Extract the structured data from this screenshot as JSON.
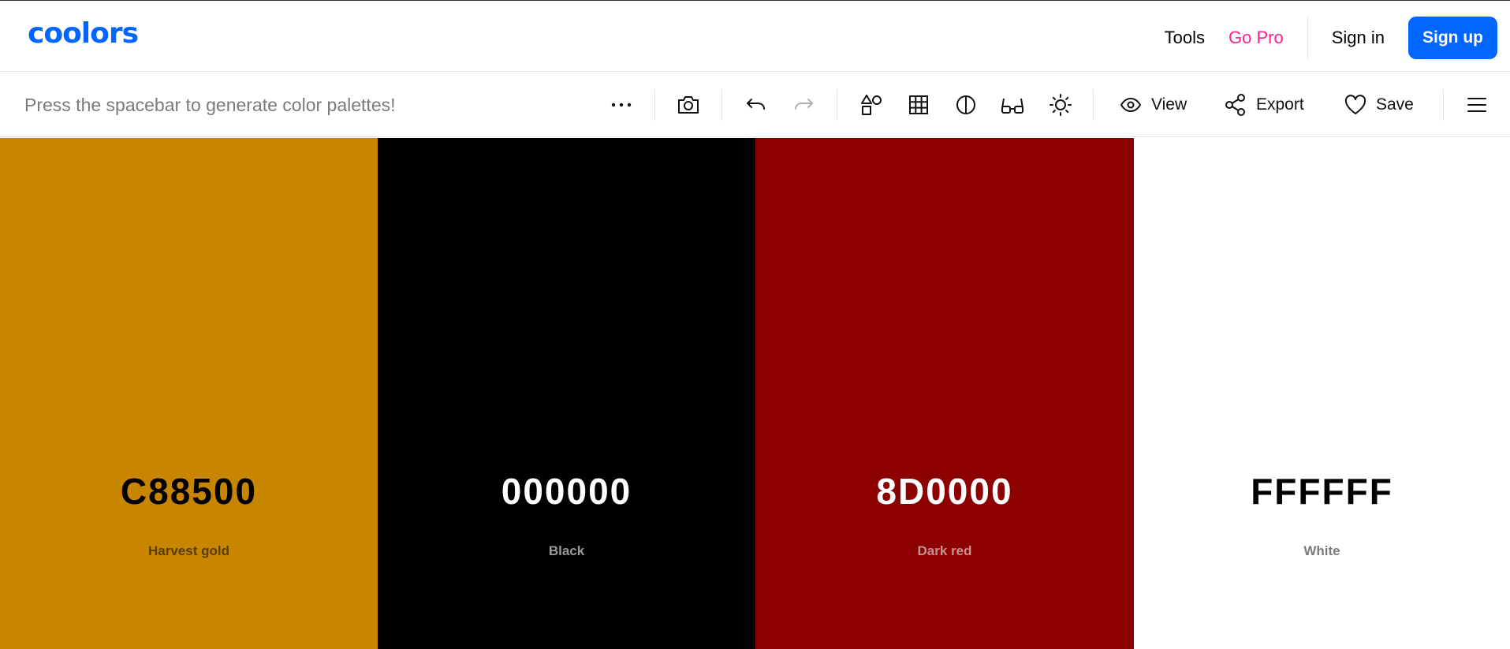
{
  "app": {
    "logo_text": "coolors"
  },
  "nav": {
    "tools_label": "Tools",
    "gopro_label": "Go Pro",
    "signin_label": "Sign in",
    "signup_label": "Sign up"
  },
  "toolbar": {
    "hint_text": "Press the spacebar to generate color palettes!",
    "view_label": "View",
    "export_label": "Export",
    "save_label": "Save"
  },
  "colors": {
    "brand": "#0066ff",
    "gopro": "#ff1f8e"
  },
  "palette": [
    {
      "hex": "C88500",
      "name": "Harvest gold",
      "bg": "#c88500",
      "hex_color": "#000000",
      "name_color": "#5a3c00"
    },
    {
      "hex": "000000",
      "name": "Black",
      "bg": "#000000",
      "hex_color": "#ffffff",
      "name_color": "#9a9a9a"
    },
    {
      "hex": "8D0000",
      "name": "Dark red",
      "bg": "#8d0000",
      "hex_color": "#ffffff",
      "name_color": "#c89090"
    },
    {
      "hex": "FFFFFF",
      "name": "White",
      "bg": "#ffffff",
      "hex_color": "#000000",
      "name_color": "#7a7a7a"
    }
  ]
}
